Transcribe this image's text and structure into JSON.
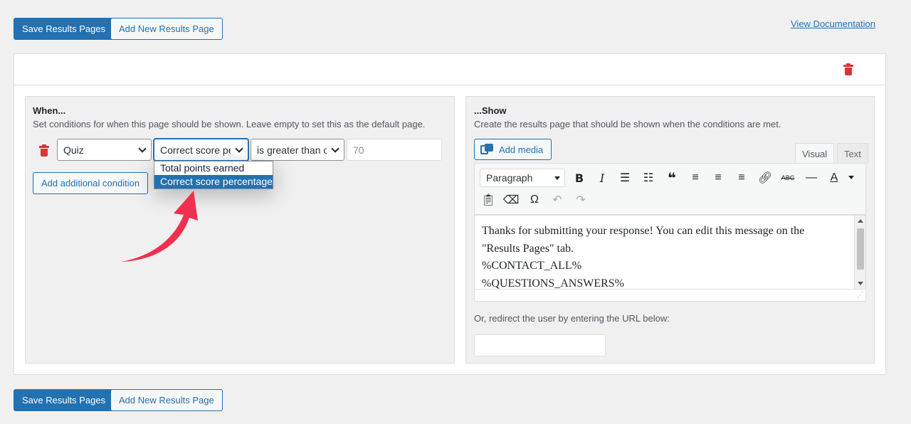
{
  "top_bar": {
    "save_label": "Save Results Pages",
    "add_label": "Add New Results Page",
    "doc_link": "View Documentation"
  },
  "when_panel": {
    "title": "When...",
    "description": "Set conditions for when this page should be shown. Leave empty to set this as the default page.",
    "category_select": "Quiz",
    "metric_select": "Correct score pe",
    "operator_select": "is greater than o",
    "value_input": "70",
    "add_condition_label": "Add additional condition",
    "dropdown_options": [
      "Total points earned",
      "Correct score percentage"
    ],
    "dropdown_selected_index": 1
  },
  "show_panel": {
    "title": "...Show",
    "description": "Create the results page that should be shown when the conditions are met.",
    "add_media_label": "Add media",
    "tabs": [
      "Visual",
      "Text"
    ],
    "active_tab": "Visual",
    "format_select": "Paragraph",
    "editor_lines": [
      "Thanks for submitting your response! You can edit this message on the",
      "\"Results Pages\" tab.",
      "%CONTACT_ALL%",
      "%QUESTIONS_ANSWERS%"
    ],
    "redirect_label": "Or, redirect the user by entering the URL below:",
    "redirect_value": ""
  },
  "bottom_bar": {
    "save_label": "Save Results Pages",
    "add_label": "Add New Results Page"
  },
  "colors": {
    "primary": "#2271b1",
    "danger": "#d63638",
    "arrow": "#f0304f",
    "background": "#f0f0f1"
  },
  "toolbar_icons": [
    "bold-icon",
    "italic-icon",
    "bullet-list-icon",
    "numbered-list-icon",
    "blockquote-icon",
    "align-left-icon",
    "align-center-icon",
    "align-right-icon",
    "link-icon",
    "strikethrough-icon",
    "horizontal-rule-icon",
    "text-color-icon",
    "paste-text-icon",
    "clear-formatting-icon",
    "special-character-icon",
    "undo-icon",
    "redo-icon"
  ]
}
